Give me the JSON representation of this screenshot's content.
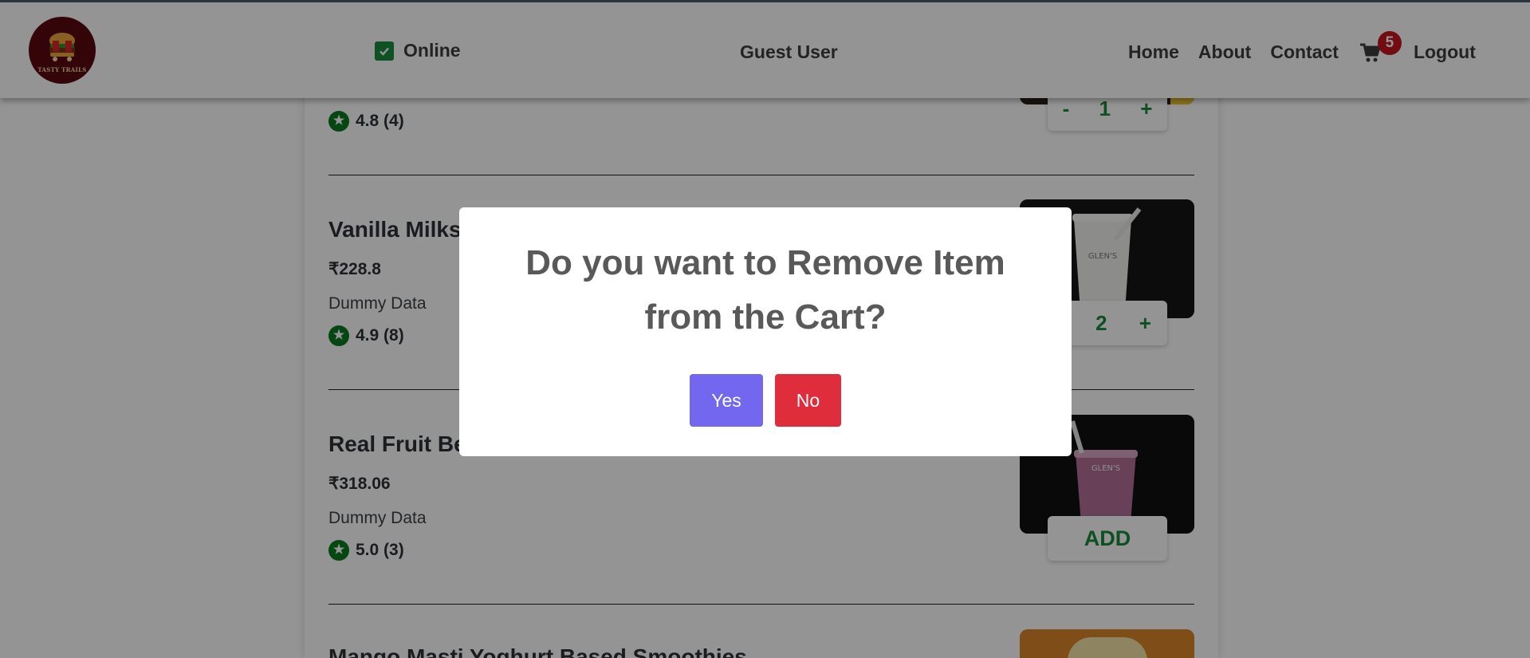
{
  "header": {
    "logo_text": "TASTY TRAILS",
    "online_label": "Online",
    "user_name": "Guest User",
    "nav": {
      "home": "Home",
      "about": "About",
      "contact": "Contact",
      "cart_count": "5",
      "logout": "Logout"
    }
  },
  "menu_items": [
    {
      "rating": "4.8 (4)",
      "quantity": "1",
      "minus": "-",
      "plus": "+"
    },
    {
      "name": "Vanilla Milkshake",
      "price": "₹228.8",
      "description": "Dummy Data",
      "rating": "4.9 (8)",
      "quantity": "2",
      "plus": "+"
    },
    {
      "name": "Real Fruit Berry Smoothie",
      "price": "₹318.06",
      "description": "Dummy Data",
      "rating": "5.0 (3)",
      "add_label": "ADD"
    },
    {
      "name": "Mango Masti Yoghurt Based Smoothies"
    }
  ],
  "modal": {
    "title": "Do you want to Remove Item from the Cart?",
    "yes_label": "Yes",
    "no_label": "No"
  },
  "colors": {
    "accent_green": "#1b8a3c",
    "yes_button": "#7367f0",
    "no_button": "#e02d3c",
    "cart_badge": "#c6151d"
  },
  "icons": {
    "online_checkbox": "checkbox-checked-icon",
    "cart": "cart-icon",
    "rating": "star-icon"
  }
}
